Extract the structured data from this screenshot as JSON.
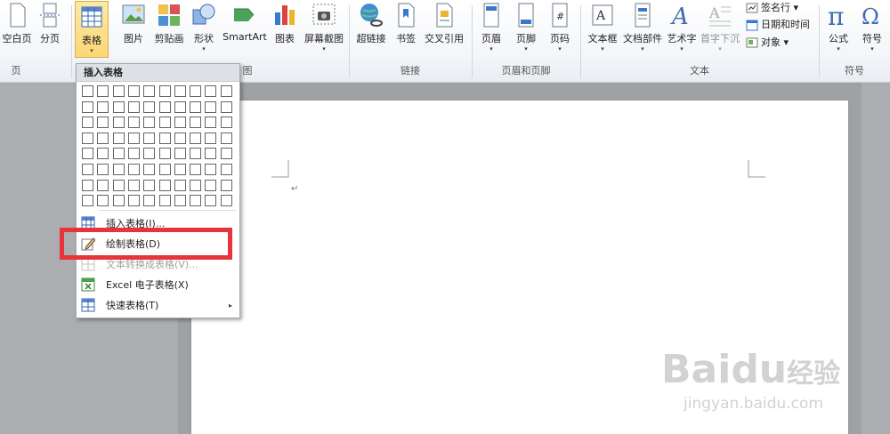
{
  "ribbon": {
    "buttons": [
      {
        "label": "空白页",
        "icon": "blank-page-icon"
      },
      {
        "label": "分页",
        "icon": "page-break-icon"
      },
      {
        "label": "表格",
        "icon": "table-icon",
        "dropdown": "▾"
      },
      {
        "label": "图片",
        "icon": "picture-icon"
      },
      {
        "label": "剪贴画",
        "icon": "clipart-icon"
      },
      {
        "label": "形状",
        "icon": "shapes-icon",
        "dropdown": "▾"
      },
      {
        "label": "SmartArt",
        "icon": "smartart-icon"
      },
      {
        "label": "图表",
        "icon": "chart-icon"
      },
      {
        "label": "屏幕截图",
        "icon": "screenshot-icon",
        "dropdown": "▾"
      },
      {
        "label": "超链接",
        "icon": "hyperlink-icon"
      },
      {
        "label": "书签",
        "icon": "bookmark-icon"
      },
      {
        "label": "交叉引用",
        "icon": "cross-reference-icon"
      },
      {
        "label": "页眉",
        "icon": "header-icon",
        "dropdown": "▾"
      },
      {
        "label": "页脚",
        "icon": "footer-icon",
        "dropdown": "▾"
      },
      {
        "label": "页码",
        "icon": "page-number-icon",
        "dropdown": "▾"
      },
      {
        "label": "文本框",
        "icon": "textbox-icon",
        "dropdown": "▾"
      },
      {
        "label": "文档部件",
        "icon": "quick-parts-icon",
        "dropdown": "▾"
      },
      {
        "label": "艺术字",
        "icon": "wordart-icon",
        "dropdown": "▾"
      },
      {
        "label": "首字下沉",
        "icon": "drop-cap-icon",
        "dropdown": "▾"
      },
      {
        "label": "公式",
        "icon": "equation-icon",
        "dropdown": "▾"
      },
      {
        "label": "符号",
        "icon": "symbol-icon",
        "dropdown": "▾"
      }
    ],
    "small_buttons": [
      {
        "label": "签名行 ▾",
        "icon": "signature-line-icon"
      },
      {
        "label": "日期和时间",
        "icon": "date-time-icon"
      },
      {
        "label": "对象 ▾",
        "icon": "object-icon"
      }
    ],
    "groups": [
      "页",
      "链接",
      "页眉和页脚",
      "文本",
      "符号"
    ],
    "group_tail": "图"
  },
  "menu": {
    "title": "插入表格",
    "grid_cols": 10,
    "grid_rows": 8,
    "items": [
      {
        "label": "插入表格(I)...",
        "icon": "insert-table-icon",
        "enabled": true
      },
      {
        "label": "绘制表格(D)",
        "icon": "draw-table-icon",
        "enabled": true
      },
      {
        "label": "文本转换成表格(V)...",
        "icon": "text-to-table-icon",
        "enabled": false
      },
      {
        "label": "Excel 电子表格(X)",
        "icon": "excel-spreadsheet-icon",
        "enabled": true
      },
      {
        "label": "快速表格(T)",
        "icon": "quick-tables-icon",
        "enabled": true,
        "submenu": "▸"
      }
    ]
  },
  "document": {
    "paragraph_mark": "↵"
  },
  "watermark": {
    "brand": "Bai",
    "paw": "du",
    "cn": "经验",
    "url": "jingyan.baidu.com"
  }
}
